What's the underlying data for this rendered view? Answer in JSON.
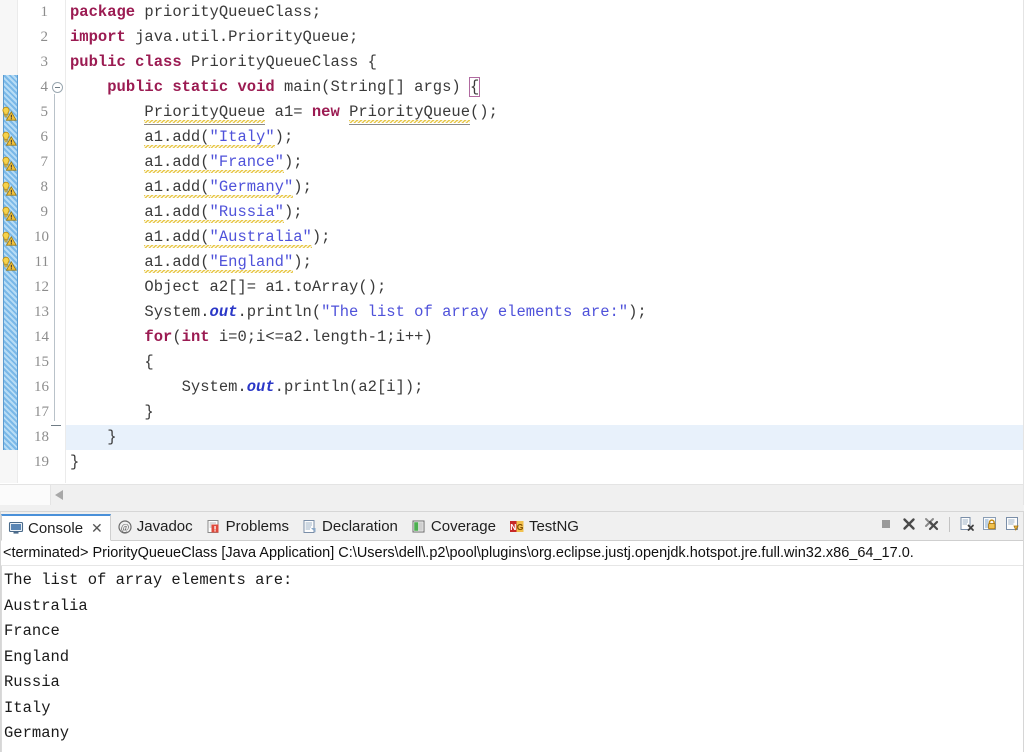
{
  "editor": {
    "name": "java-source-editor",
    "current_line": 18,
    "lines": [
      {
        "num": 1,
        "warning": false,
        "tokens": [
          {
            "t": "package",
            "c": "kw"
          },
          {
            "t": " priorityQueueClass;",
            "c": "pln"
          }
        ]
      },
      {
        "num": 2,
        "warning": false,
        "tokens": [
          {
            "t": "import",
            "c": "kw"
          },
          {
            "t": " java.util.PriorityQueue;",
            "c": "pln"
          }
        ]
      },
      {
        "num": 3,
        "warning": false,
        "tokens": [
          {
            "t": "public class",
            "c": "kw"
          },
          {
            "t": " PriorityQueueClass {",
            "c": "pln"
          }
        ]
      },
      {
        "num": 4,
        "warning": false,
        "tokens": [
          {
            "t": "    ",
            "c": "pln"
          },
          {
            "t": "public static void",
            "c": "kw"
          },
          {
            "t": " main(String[] args) ",
            "c": "pln"
          },
          {
            "t": "{",
            "c": "brbox"
          }
        ]
      },
      {
        "num": 5,
        "warning": true,
        "tokens": [
          {
            "t": "        ",
            "c": "pln"
          },
          {
            "t": "PriorityQueue",
            "c": "ul sq"
          },
          {
            "t": " a1= ",
            "c": "pln"
          },
          {
            "t": "new",
            "c": "kw"
          },
          {
            "t": " ",
            "c": "pln"
          },
          {
            "t": "PriorityQueue",
            "c": "ul sq"
          },
          {
            "t": "();",
            "c": "pln"
          }
        ]
      },
      {
        "num": 6,
        "warning": true,
        "tokens": [
          {
            "t": "        ",
            "c": "pln"
          },
          {
            "t": "a1.add(",
            "c": "pln sq"
          },
          {
            "t": "\"Italy\"",
            "c": "str sq"
          },
          {
            "t": ");",
            "c": "pln"
          }
        ]
      },
      {
        "num": 7,
        "warning": true,
        "tokens": [
          {
            "t": "        ",
            "c": "pln"
          },
          {
            "t": "a1.add(",
            "c": "pln sq"
          },
          {
            "t": "\"France\"",
            "c": "str sq"
          },
          {
            "t": ");",
            "c": "pln"
          }
        ]
      },
      {
        "num": 8,
        "warning": true,
        "tokens": [
          {
            "t": "        ",
            "c": "pln"
          },
          {
            "t": "a1.add(",
            "c": "pln sq"
          },
          {
            "t": "\"Germany\"",
            "c": "str sq"
          },
          {
            "t": ");",
            "c": "pln"
          }
        ]
      },
      {
        "num": 9,
        "warning": true,
        "tokens": [
          {
            "t": "        ",
            "c": "pln"
          },
          {
            "t": "a1.add(",
            "c": "pln sq"
          },
          {
            "t": "\"Russia\"",
            "c": "str sq"
          },
          {
            "t": ");",
            "c": "pln"
          }
        ]
      },
      {
        "num": 10,
        "warning": true,
        "tokens": [
          {
            "t": "        ",
            "c": "pln"
          },
          {
            "t": "a1.add(",
            "c": "pln sq"
          },
          {
            "t": "\"Australia\"",
            "c": "str sq"
          },
          {
            "t": ");",
            "c": "pln"
          }
        ]
      },
      {
        "num": 11,
        "warning": true,
        "tokens": [
          {
            "t": "        ",
            "c": "pln"
          },
          {
            "t": "a1.add(",
            "c": "pln sq"
          },
          {
            "t": "\"England\"",
            "c": "str sq"
          },
          {
            "t": ");",
            "c": "pln"
          }
        ]
      },
      {
        "num": 12,
        "warning": false,
        "tokens": [
          {
            "t": "        Object a2[]= a1.toArray();",
            "c": "pln"
          }
        ]
      },
      {
        "num": 13,
        "warning": false,
        "tokens": [
          {
            "t": "        System.",
            "c": "pln"
          },
          {
            "t": "out",
            "c": "fld"
          },
          {
            "t": ".println(",
            "c": "pln"
          },
          {
            "t": "\"The list of array elements are:\"",
            "c": "str"
          },
          {
            "t": ");",
            "c": "pln"
          }
        ]
      },
      {
        "num": 14,
        "warning": false,
        "tokens": [
          {
            "t": "        ",
            "c": "pln"
          },
          {
            "t": "for",
            "c": "kw"
          },
          {
            "t": "(",
            "c": "pln"
          },
          {
            "t": "int",
            "c": "kw"
          },
          {
            "t": " i=0;i<=a2.length-1;i++)",
            "c": "pln"
          }
        ]
      },
      {
        "num": 15,
        "warning": false,
        "tokens": [
          {
            "t": "        {",
            "c": "pln"
          }
        ]
      },
      {
        "num": 16,
        "warning": false,
        "tokens": [
          {
            "t": "            System.",
            "c": "pln"
          },
          {
            "t": "out",
            "c": "fld"
          },
          {
            "t": ".println(a2[i]);",
            "c": "pln"
          }
        ]
      },
      {
        "num": 17,
        "warning": false,
        "tokens": [
          {
            "t": "        }",
            "c": "pln"
          }
        ]
      },
      {
        "num": 18,
        "warning": false,
        "tokens": [
          {
            "t": "    }",
            "c": "pln"
          }
        ]
      },
      {
        "num": 19,
        "warning": false,
        "tokens": [
          {
            "t": "}",
            "c": "pln"
          }
        ]
      }
    ],
    "fold_marker_line": 4,
    "scrollbar": {
      "left_arrow": "scroll-left-arrow"
    }
  },
  "console_panel": {
    "tabs": [
      {
        "label": "Console",
        "icon": "console-icon",
        "active": true,
        "closable": true
      },
      {
        "label": "Javadoc",
        "icon": "javadoc-icon",
        "active": false,
        "closable": false
      },
      {
        "label": "Problems",
        "icon": "problems-icon",
        "active": false,
        "closable": false
      },
      {
        "label": "Declaration",
        "icon": "declaration-icon",
        "active": false,
        "closable": false
      },
      {
        "label": "Coverage",
        "icon": "coverage-icon",
        "active": false,
        "closable": false
      },
      {
        "label": "TestNG",
        "icon": "testng-icon",
        "active": false,
        "closable": false
      }
    ],
    "toolbar_icons": [
      "terminate-icon",
      "remove-launch-icon",
      "remove-all-terminated-icon",
      "separator",
      "clear-console-icon",
      "scroll-lock-icon",
      "pin-console-icon"
    ],
    "launch_header": "<terminated> PriorityQueueClass [Java Application] C:\\Users\\dell\\.p2\\pool\\plugins\\org.eclipse.justj.openjdk.hotspot.jre.full.win32.x86_64_17.0.",
    "output_lines": [
      "The list of array elements are:",
      "Australia",
      "France",
      "England",
      "Russia",
      "Italy",
      "Germany"
    ]
  },
  "colors": {
    "keyword": "#9b1b52",
    "string": "#4f52da",
    "field": "#2a37c7",
    "current_line_highlight": "#e8f1fb",
    "active_tab_accent": "#4a90d9",
    "change_bar": "#7ab8e8",
    "warning_squiggle": "#e8c84b"
  }
}
